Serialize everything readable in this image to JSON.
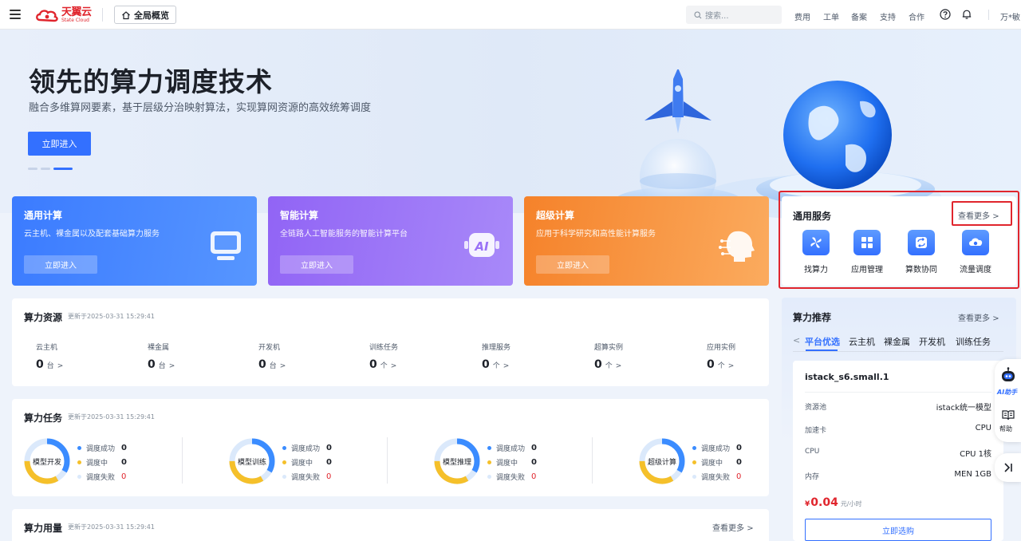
{
  "header": {
    "logo_cn": "天翼云",
    "logo_en": "State Cloud",
    "overview_label": "全局概览",
    "search_placeholder": "搜索...",
    "nav": [
      "费用",
      "工单",
      "备案",
      "支持",
      "合作"
    ],
    "user": "万*敏"
  },
  "hero": {
    "title": "领先的算力调度技术",
    "subtitle": "融合多维算网要素，基于层级分治映射算法，实现算网资源的高效统筹调度",
    "button": "立即进入"
  },
  "cards": [
    {
      "title": "通用计算",
      "desc": "云主机、裸金属以及配套基础算力服务",
      "button": "立即进入"
    },
    {
      "title": "智能计算",
      "desc": "全链路人工智能服务的智能计算平台",
      "button": "立即进入"
    },
    {
      "title": "超级计算",
      "desc": "应用于科学研究和高性能计算服务",
      "button": "立即进入"
    }
  ],
  "services": {
    "title": "通用服务",
    "more": "查看更多",
    "items": [
      {
        "label": "找算力",
        "icon": "pinwheel-icon"
      },
      {
        "label": "应用管理",
        "icon": "grid-icon"
      },
      {
        "label": "算数协同",
        "icon": "sync-icon"
      },
      {
        "label": "流量调度",
        "icon": "cloud-icon"
      }
    ]
  },
  "resources": {
    "title": "算力资源",
    "updated": "更新于2025-03-31 15:29:41",
    "items": [
      {
        "label": "云主机",
        "value": "0",
        "unit": "台"
      },
      {
        "label": "裸金属",
        "value": "0",
        "unit": "台"
      },
      {
        "label": "开发机",
        "value": "0",
        "unit": "台"
      },
      {
        "label": "训练任务",
        "value": "0",
        "unit": "个"
      },
      {
        "label": "推理服务",
        "value": "0",
        "unit": "个"
      },
      {
        "label": "超算实例",
        "value": "0",
        "unit": "个"
      },
      {
        "label": "应用实例",
        "value": "0",
        "unit": "个"
      }
    ]
  },
  "tasks": {
    "title": "算力任务",
    "updated": "更新于2025-03-31 15:29:41",
    "legend": [
      "调度成功",
      "调度中",
      "调度失败"
    ],
    "items": [
      {
        "label": "模型开发",
        "success": "0",
        "pending": "0",
        "failed": "0"
      },
      {
        "label": "模型训练",
        "success": "0",
        "pending": "0",
        "failed": "0"
      },
      {
        "label": "模型推理",
        "success": "0",
        "pending": "0",
        "failed": "0"
      },
      {
        "label": "超级计算",
        "success": "0",
        "pending": "0",
        "failed": "0"
      }
    ]
  },
  "usage": {
    "title": "算力用量",
    "updated": "更新于2025-03-31 15:29:41",
    "more": "查看更多"
  },
  "recommend": {
    "title": "算力推荐",
    "more": "查看更多",
    "tabs": [
      "平台优选",
      "云主机",
      "裸金属",
      "开发机",
      "训练任务"
    ],
    "spec": {
      "name": "istack_s6.small.1",
      "rows": [
        {
          "k": "资源池",
          "v": "istack统一模型"
        },
        {
          "k": "加速卡",
          "v": "CPU"
        },
        {
          "k": "CPU",
          "v": "CPU 1核"
        },
        {
          "k": "内存",
          "v": "MEN 1GB"
        }
      ],
      "currency": "¥",
      "price": "0.04",
      "price_unit": "元/小时",
      "buy": "立即选购"
    }
  },
  "float": {
    "ai": "AI助手",
    "help": "帮助"
  },
  "colors": {
    "accent": "#3370ff",
    "highlight": "#e0252d",
    "success": "#3b8cff",
    "pending": "#f5c02a",
    "failed": "#dbe9fb"
  }
}
